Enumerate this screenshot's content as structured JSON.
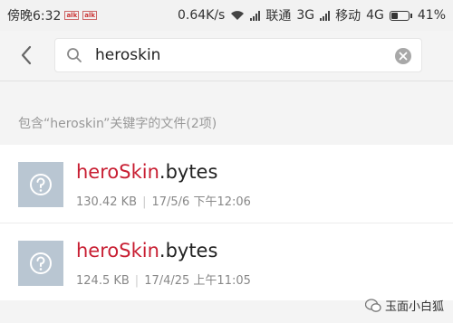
{
  "status_bar": {
    "carrier_time": "傍晚6:32",
    "speed": "0.64K/s",
    "carrier1": "联通",
    "net1": "3G",
    "carrier2": "移动",
    "net2": "4G",
    "battery": "41%",
    "battery_level": 0.41,
    "mini_icons": [
      "alk",
      "alk"
    ]
  },
  "search": {
    "query": "heroskin",
    "placeholder": "",
    "icons": {
      "back": "chevron-left-icon",
      "search": "search-icon",
      "clear": "clear-icon"
    }
  },
  "results": {
    "label": "包含“heroskin”关键字的文件(2项)",
    "files": [
      {
        "name_highlight": "heroSkin",
        "name_rest": ".bytes",
        "size": "130.42 KB",
        "date": "17/5/6 下午12:06"
      },
      {
        "name_highlight": "heroSkin",
        "name_rest": ".bytes",
        "size": "124.5 KB",
        "date": "17/4/25 上午11:05"
      }
    ]
  },
  "watermark": {
    "text": "玉面小白狐"
  },
  "colors": {
    "highlight": "#c81e32",
    "thumb": "#b9c6d2"
  }
}
